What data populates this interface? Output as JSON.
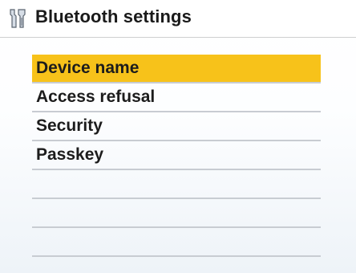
{
  "header": {
    "title": "Bluetooth settings",
    "icon": "tools-icon"
  },
  "menu": {
    "items": [
      {
        "label": "Device name",
        "selected": true
      },
      {
        "label": "Access refusal",
        "selected": false
      },
      {
        "label": "Security",
        "selected": false
      },
      {
        "label": "Passkey",
        "selected": false
      }
    ],
    "empty_rows": 3
  },
  "colors": {
    "selection": "#f7c21a",
    "divider": "#c8ccd2"
  }
}
